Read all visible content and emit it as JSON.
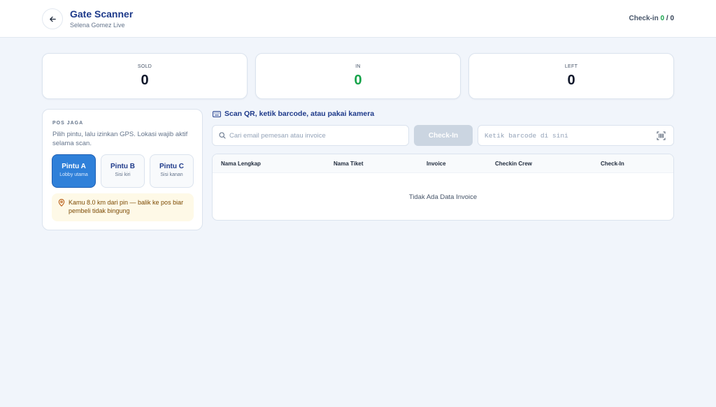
{
  "header": {
    "title": "Gate Scanner",
    "subtitle": "Selena Gomez Live",
    "checkin_label": "Check-in",
    "checkin_done": "0",
    "checkin_sep": " / ",
    "checkin_total": "0"
  },
  "stats": {
    "sold": {
      "label": "SOLD",
      "value": "0"
    },
    "in": {
      "label": "IN",
      "value": "0"
    },
    "left": {
      "label": "LEFT",
      "value": "0"
    }
  },
  "pos": {
    "heading": "POS JAGA",
    "description": "Pilih pintu, lalu izinkan GPS. Lokasi wajib aktif selama scan.",
    "gates": [
      {
        "name": "Pintu A",
        "sub": "Lobby utama",
        "active": true
      },
      {
        "name": "Pintu B",
        "sub": "Sisi kiri",
        "active": false
      },
      {
        "name": "Pintu C",
        "sub": "Sisi kanan",
        "active": false
      }
    ],
    "warning": "Kamu 8.0 km dari pin — balik ke pos biar pembeli tidak bingung"
  },
  "scan": {
    "title": "Scan QR, ketik barcode, atau pakai kamera",
    "search_placeholder": "Cari email pemesan atau invoice",
    "search_value": "",
    "checkin_button": "Check-In",
    "barcode_placeholder": "Ketik barcode di sini",
    "barcode_value": ""
  },
  "table": {
    "columns": [
      "Nama Lengkap",
      "Nama Tiket",
      "Invoice",
      "Checkin Crew",
      "Check-In"
    ],
    "rows": [],
    "empty_text": "Tidak Ada Data Invoice"
  },
  "icons": {
    "back": "arrow-left-icon",
    "keyboard": "keyboard-icon",
    "search": "search-icon",
    "barcode": "barcode-scan-icon",
    "location": "map-pin-icon"
  },
  "colors": {
    "primary": "#2f80d9",
    "title": "#1e3a8a",
    "success": "#16a34a",
    "warning_bg": "#fef9e7",
    "disabled": "#cbd5e1"
  }
}
